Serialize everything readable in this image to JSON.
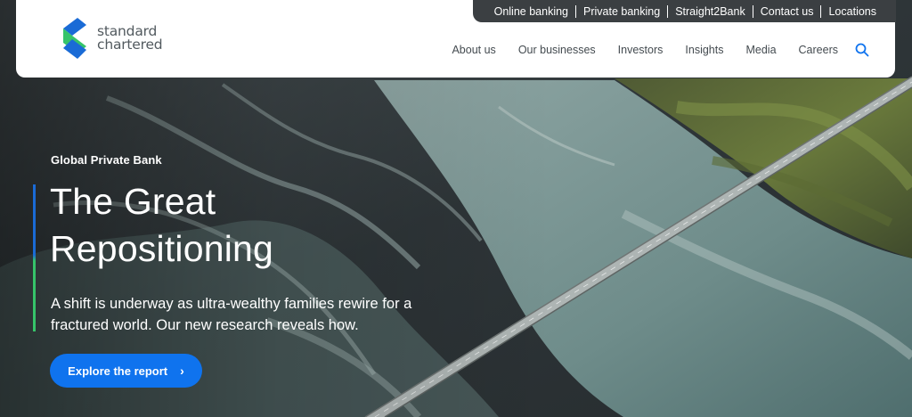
{
  "utility_nav": [
    {
      "label": "Online banking"
    },
    {
      "label": "Private banking"
    },
    {
      "label": "Straight2Bank"
    },
    {
      "label": "Contact us"
    },
    {
      "label": "Locations"
    }
  ],
  "brand": {
    "line1": "standard",
    "line2": "chartered"
  },
  "main_nav": [
    {
      "label": "About us"
    },
    {
      "label": "Our businesses"
    },
    {
      "label": "Investors"
    },
    {
      "label": "Insights"
    },
    {
      "label": "Media"
    },
    {
      "label": "Careers"
    }
  ],
  "hero": {
    "eyebrow": "Global Private Bank",
    "headline_line1": "The Great",
    "headline_line2": "Repositioning",
    "subtext": "A shift is underway as ultra-wealthy families rewire for a fractured world. Our new research reveals how.",
    "cta_label": "Explore the report"
  },
  "colors": {
    "accent_blue": "#0f73ee",
    "accent_green": "#36c46a",
    "utility_bar": "#3b3f42",
    "nav_text": "#444b50"
  },
  "icons": {
    "search": "search-icon",
    "cta_arrow": "chevron-right-icon",
    "logo": "logo-mark-icon"
  }
}
